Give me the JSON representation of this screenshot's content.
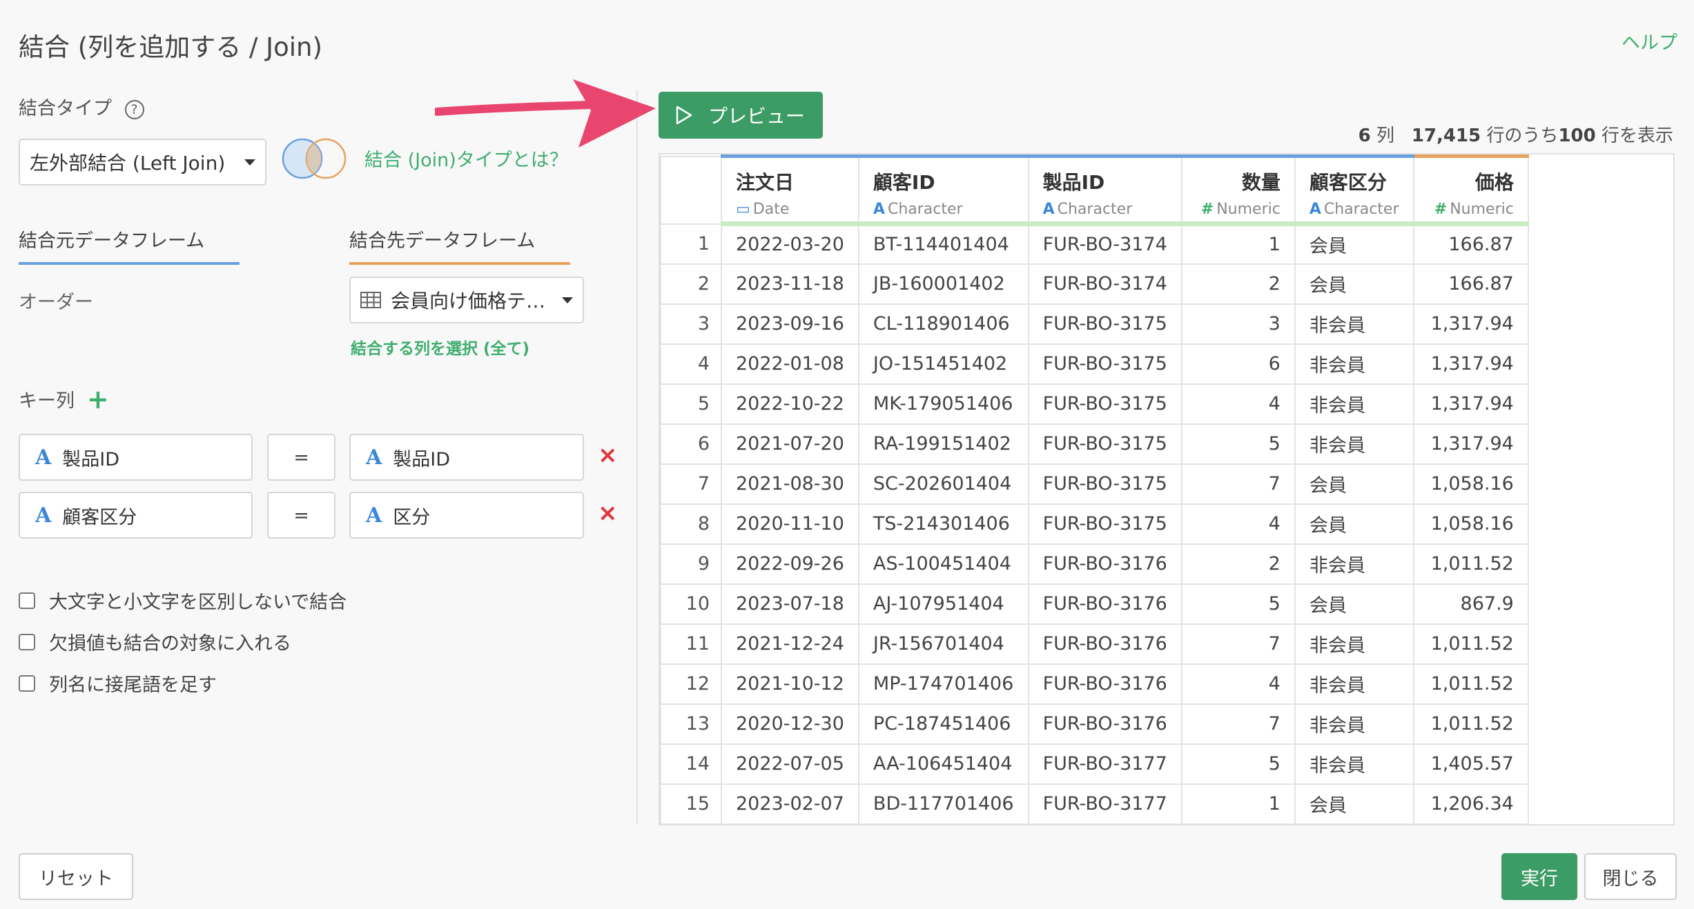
{
  "dialog": {
    "title": "結合 (列を追加する / Join)",
    "help": "ヘルプ"
  },
  "join_type": {
    "label": "結合タイプ",
    "help_icon": "?",
    "selected": "左外部結合 (Left Join)",
    "about_link": "結合 (Join)タイプとは？"
  },
  "dataframes": {
    "source_tab": "結合元データフレーム",
    "target_tab": "結合先データフレーム",
    "source_name": "オーダー",
    "target_selected": "会員向け価格テー...",
    "select_columns_link": "結合する列を選択 (全て)"
  },
  "keys": {
    "label": "キー列",
    "add_icon": "+",
    "rows": [
      {
        "left": "製品ID",
        "op": "=",
        "right": "製品ID",
        "type_icon": "A"
      },
      {
        "left": "顧客区分",
        "op": "=",
        "right": "区分",
        "type_icon": "A"
      }
    ],
    "delete_icon": "×"
  },
  "options": [
    {
      "label": "大文字と小文字を区別しないで結合",
      "checked": false
    },
    {
      "label": "欠損値も結合の対象に入れる",
      "checked": false
    },
    {
      "label": "列名に接尾語を足す",
      "checked": false
    }
  ],
  "preview": {
    "button": "プレビュー",
    "cols_count": "6",
    "cols_unit": "列",
    "total_rows": "17,415",
    "rows_mid": "行のうち",
    "shown_rows": "100",
    "rows_suffix": "行を表示"
  },
  "table": {
    "columns": [
      {
        "name": "注文日",
        "type": "Date",
        "icon": "calendar-icon",
        "glyph": "▭",
        "align": "left",
        "top_color": "#6aa0dd"
      },
      {
        "name": "顧客ID",
        "type": "Character",
        "icon": "character-icon",
        "glyph": "A",
        "align": "left",
        "top_color": "#6aa0dd"
      },
      {
        "name": "製品ID",
        "type": "Character",
        "icon": "character-icon",
        "glyph": "A",
        "align": "left",
        "top_color": "#6aa0dd"
      },
      {
        "name": "数量",
        "type": "Numeric",
        "icon": "numeric-icon",
        "glyph": "#",
        "align": "right",
        "top_color": "#6aa0dd"
      },
      {
        "name": "顧客区分",
        "type": "Character",
        "icon": "character-icon",
        "glyph": "A",
        "align": "left",
        "top_color": "#6aa0dd"
      },
      {
        "name": "価格",
        "type": "Numeric",
        "icon": "numeric-icon",
        "glyph": "#",
        "align": "right",
        "top_color": "#e8a25c"
      }
    ],
    "rows": [
      [
        "1",
        "2022-03-20",
        "BT-114401404",
        "FUR-BO-3174",
        "1",
        "会員",
        "166.87"
      ],
      [
        "2",
        "2023-11-18",
        "JB-160001402",
        "FUR-BO-3174",
        "2",
        "会員",
        "166.87"
      ],
      [
        "3",
        "2023-09-16",
        "CL-118901406",
        "FUR-BO-3175",
        "3",
        "非会員",
        "1,317.94"
      ],
      [
        "4",
        "2022-01-08",
        "JO-151451402",
        "FUR-BO-3175",
        "6",
        "非会員",
        "1,317.94"
      ],
      [
        "5",
        "2022-10-22",
        "MK-179051406",
        "FUR-BO-3175",
        "4",
        "非会員",
        "1,317.94"
      ],
      [
        "6",
        "2021-07-20",
        "RA-199151402",
        "FUR-BO-3175",
        "5",
        "非会員",
        "1,317.94"
      ],
      [
        "7",
        "2021-08-30",
        "SC-202601404",
        "FUR-BO-3175",
        "7",
        "会員",
        "1,058.16"
      ],
      [
        "8",
        "2020-11-10",
        "TS-214301406",
        "FUR-BO-3175",
        "4",
        "会員",
        "1,058.16"
      ],
      [
        "9",
        "2022-09-26",
        "AS-100451404",
        "FUR-BO-3176",
        "2",
        "非会員",
        "1,011.52"
      ],
      [
        "10",
        "2023-07-18",
        "AJ-107951404",
        "FUR-BO-3176",
        "5",
        "会員",
        "867.9"
      ],
      [
        "11",
        "2021-12-24",
        "JR-156701404",
        "FUR-BO-3176",
        "7",
        "非会員",
        "1,011.52"
      ],
      [
        "12",
        "2021-10-12",
        "MP-174701406",
        "FUR-BO-3176",
        "4",
        "非会員",
        "1,011.52"
      ],
      [
        "13",
        "2020-12-30",
        "PC-187451406",
        "FUR-BO-3176",
        "7",
        "非会員",
        "1,011.52"
      ],
      [
        "14",
        "2022-07-05",
        "AA-106451404",
        "FUR-BO-3177",
        "5",
        "非会員",
        "1,405.57"
      ],
      [
        "15",
        "2023-02-07",
        "BD-117701406",
        "FUR-BO-3177",
        "1",
        "会員",
        "1,206.34"
      ]
    ]
  },
  "footer": {
    "reset": "リセット",
    "run": "実行",
    "close": "閉じる"
  },
  "colors": {
    "accent_green": "#3c9c65",
    "link_green": "#3fae6f",
    "delete_red": "#e0353b",
    "arrow_pink": "#e8456f"
  }
}
